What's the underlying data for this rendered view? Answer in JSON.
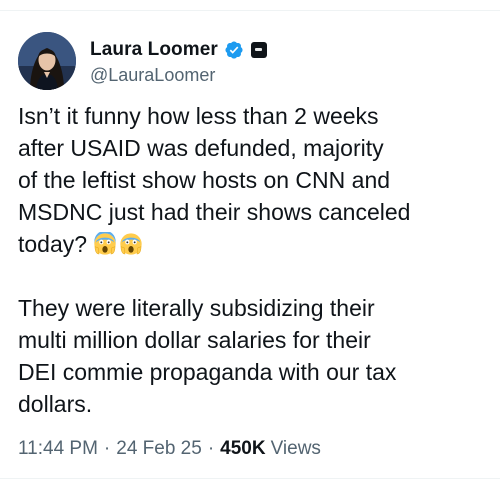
{
  "author": {
    "display_name": "Laura Loomer",
    "handle": "@LauraLoomer",
    "avatar_icon": "profile-photo",
    "verified_icon": "verified-badge-icon",
    "affiliate_icon": "affiliate-badge-icon",
    "verified_color": "#1d9bf0"
  },
  "tweet": {
    "paragraph_1": "Isn’t it funny how less than 2 weeks\nafter USAID was defunded, majority\nof the leftist show hosts on CNN and\nMSDNC just had their shows canceled\ntoday?",
    "emojis": [
      "😱",
      "😱"
    ],
    "paragraph_2": "They were literally subsidizing their\nmulti million dollar salaries for their\nDEI commie propaganda with our tax\ndollars."
  },
  "meta": {
    "time": "11:44 PM",
    "separator": "·",
    "date": "24 Feb 25",
    "views_count": "450K",
    "views_label": "Views"
  },
  "colors": {
    "text": "#0f1419",
    "secondary": "#536471",
    "divider": "#eff3f4"
  }
}
